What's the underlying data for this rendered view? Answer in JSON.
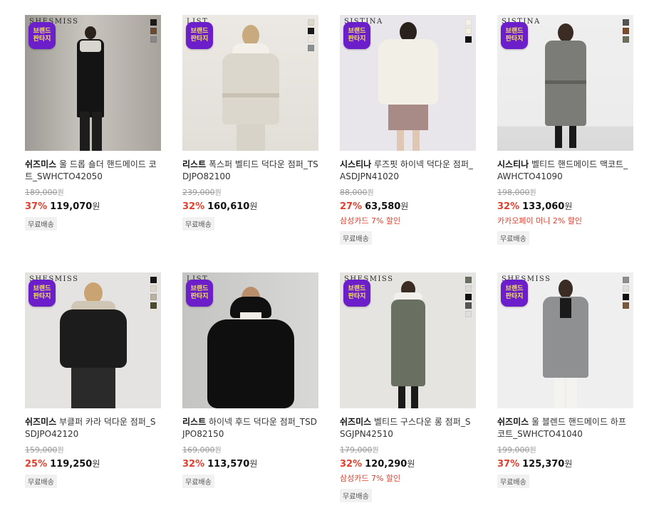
{
  "badge": {
    "line1": "브랜드",
    "line2": "판타지",
    "bg": "#6b1ec9",
    "fg": "#f5e45a"
  },
  "products": [
    {
      "brand_logo": "SHESMISS",
      "brand": "쉬즈미스",
      "name": "울 드롭 숄더 핸드메이드 코트_SWHCTO42050",
      "original_price": "189,000",
      "discount": "37%",
      "price": "119,070",
      "won": "원",
      "promo": "",
      "shipping": "무료배송",
      "swatches": [
        "#1a1a1a",
        "#6a4b32",
        "#888888"
      ],
      "bg": "#b9b5b0"
    },
    {
      "brand_logo": "LIST",
      "brand": "리스트",
      "name": "폭스퍼 벨티드 덕다운 점퍼_TSDJPO82100",
      "original_price": "239,000",
      "discount": "32%",
      "price": "160,610",
      "won": "원",
      "promo": "",
      "shipping": "무료배송",
      "swatches": [
        "#dcd8cc",
        "#1a1a1a",
        "#ebe7df",
        "#8b8f8f"
      ],
      "bg": "#e8e4df"
    },
    {
      "brand_logo": "SISTINA",
      "brand": "시스티나",
      "name": "루즈핏 하이넥 덕다운 점퍼_ASDJPN41020",
      "original_price": "88,000",
      "discount": "27%",
      "price": "63,580",
      "won": "원",
      "promo": "삼성카드 7% 할인",
      "shipping": "무료배송",
      "swatches": [
        "#f4f1e8",
        "#f4efdd",
        "#111111"
      ],
      "bg": "#e9e7ea"
    },
    {
      "brand_logo": "SISTINA",
      "brand": "시스티나",
      "name": "벨티드 핸드메이드 맥코트_AWHCTO41090",
      "original_price": "198,000",
      "discount": "32%",
      "price": "133,060",
      "won": "원",
      "promo": "카카오페이 머니 2% 할인",
      "shipping": "무료배송",
      "swatches": [
        "#555555",
        "#7a4c2e",
        "#6e6e5c"
      ],
      "bg": "#eeeeee"
    },
    {
      "brand_logo": "SHESMISS",
      "brand": "쉬즈미스",
      "name": "부클퍼 카라 덕다운 점퍼_SSDJPO42120",
      "original_price": "159,000",
      "discount": "25%",
      "price": "119,250",
      "won": "원",
      "promo": "",
      "shipping": "무료배송",
      "swatches": [
        "#151515",
        "#ddd6c8",
        "#b8b0a0",
        "#4c4a2e"
      ],
      "bg": "#e5e4e2"
    },
    {
      "brand_logo": "LIST",
      "brand": "리스트",
      "name": "하이넥 후드 덕다운 점퍼_TSDJPO82150",
      "original_price": "169,000",
      "discount": "32%",
      "price": "113,570",
      "won": "원",
      "promo": "",
      "shipping": "무료배송",
      "swatches": [],
      "bg": "#cfcfcd"
    },
    {
      "brand_logo": "SHESMISS",
      "brand": "쉬즈미스",
      "name": "벨티드 구스다운 롱 점퍼_SSGJPN42510",
      "original_price": "179,000",
      "discount": "32%",
      "price": "120,290",
      "won": "원",
      "promo": "삼성카드 7% 할인",
      "shipping": "무료배송",
      "swatches": [
        "#6a7061",
        "#dcdad4",
        "#111111",
        "#555555",
        "#dedede"
      ],
      "bg": "#e6e4e0"
    },
    {
      "brand_logo": "SHESMISS",
      "brand": "쉬즈미스",
      "name": "울 블렌드 핸드메이드 하프코트_SWHCTO41040",
      "original_price": "199,000",
      "discount": "37%",
      "price": "125,370",
      "won": "원",
      "promo": "",
      "shipping": "무료배송",
      "swatches": [
        "#8f8f8f",
        "#e2e0dc",
        "#111111",
        "#7a5a3e"
      ],
      "bg": "#efefef"
    }
  ]
}
